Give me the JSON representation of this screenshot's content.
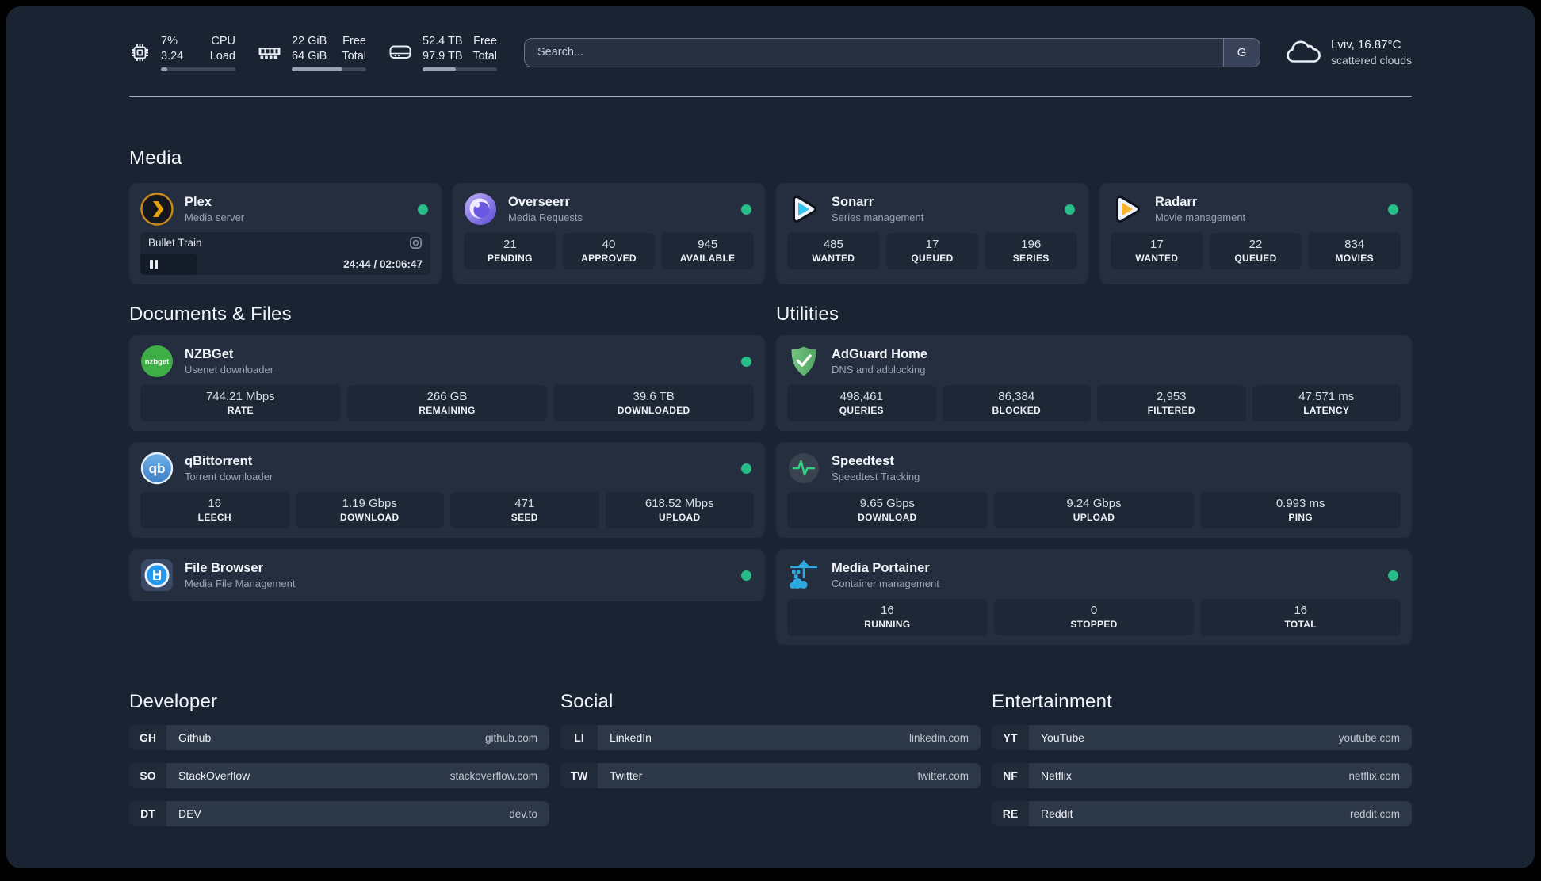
{
  "topbar": {
    "cpu": {
      "icon": "cpu-icon",
      "v1": "7%",
      "v2": "3.24",
      "l1": "CPU",
      "l2": "Load",
      "fill": "width:9%"
    },
    "memory": {
      "icon": "memory-icon",
      "v1": "22 GiB",
      "v2": "64 GiB",
      "l1": "Free",
      "l2": "Total",
      "fill": "width:68%"
    },
    "disk": {
      "icon": "disk-icon",
      "v1": "52.4 TB",
      "v2": "97.9 TB",
      "l1": "Free",
      "l2": "Total",
      "fill": "width:45%"
    },
    "search": {
      "placeholder": "Search...",
      "button_label": "G"
    },
    "weather": {
      "icon": "cloud-icon",
      "line1": "Lviv, 16.87°C",
      "line2": "scattered clouds"
    }
  },
  "media": {
    "title": "Media",
    "plex": {
      "icon": "plex-logo",
      "name": "Plex",
      "desc": "Media server",
      "status": "online",
      "player": {
        "title": "Bullet Train",
        "time": "24:44 / 02:06:47",
        "fill": "width:19.5%"
      }
    },
    "overseerr": {
      "icon": "overseerr-logo",
      "name": "Overseerr",
      "desc": "Media Requests",
      "status": "online",
      "stats": [
        {
          "value": "21",
          "label": "PENDING"
        },
        {
          "value": "40",
          "label": "APPROVED"
        },
        {
          "value": "945",
          "label": "AVAILABLE"
        }
      ]
    },
    "sonarr": {
      "icon": "sonarr-logo",
      "name": "Sonarr",
      "desc": "Series management",
      "status": "online",
      "stats": [
        {
          "value": "485",
          "label": "WANTED"
        },
        {
          "value": "17",
          "label": "QUEUED"
        },
        {
          "value": "196",
          "label": "SERIES"
        }
      ]
    },
    "radarr": {
      "icon": "radarr-logo",
      "name": "Radarr",
      "desc": "Movie management",
      "status": "online",
      "stats": [
        {
          "value": "17",
          "label": "WANTED"
        },
        {
          "value": "22",
          "label": "QUEUED"
        },
        {
          "value": "834",
          "label": "MOVIES"
        }
      ]
    }
  },
  "documents": {
    "title": "Documents & Files",
    "nzbget": {
      "icon": "nzbget-logo",
      "name": "NZBGet",
      "desc": "Usenet downloader",
      "status": "online",
      "stats": [
        {
          "value": "744.21 Mbps",
          "label": "RATE"
        },
        {
          "value": "266 GB",
          "label": "REMAINING"
        },
        {
          "value": "39.6 TB",
          "label": "DOWNLOADED"
        }
      ]
    },
    "qbittorrent": {
      "icon": "qbittorrent-logo",
      "name": "qBittorrent",
      "desc": "Torrent downloader",
      "status": "online",
      "stats": [
        {
          "value": "16",
          "label": "LEECH"
        },
        {
          "value": "1.19 Gbps",
          "label": "DOWNLOAD"
        },
        {
          "value": "471",
          "label": "SEED"
        },
        {
          "value": "618.52 Mbps",
          "label": "UPLOAD"
        }
      ]
    },
    "filebrowser": {
      "icon": "filebrowser-logo",
      "name": "File Browser",
      "desc": "Media File Management",
      "status": "online"
    }
  },
  "utilities": {
    "title": "Utilities",
    "adguard": {
      "icon": "adguard-logo",
      "name": "AdGuard Home",
      "desc": "DNS and adblocking",
      "stats": [
        {
          "value": "498,461",
          "label": "QUERIES"
        },
        {
          "value": "86,384",
          "label": "BLOCKED"
        },
        {
          "value": "2,953",
          "label": "FILTERED"
        },
        {
          "value": "47.571 ms",
          "label": "LATENCY"
        }
      ]
    },
    "speedtest": {
      "icon": "speedtest-logo",
      "name": "Speedtest",
      "desc": "Speedtest Tracking",
      "stats": [
        {
          "value": "9.65 Gbps",
          "label": "DOWNLOAD"
        },
        {
          "value": "9.24 Gbps",
          "label": "UPLOAD"
        },
        {
          "value": "0.993 ms",
          "label": "PING"
        }
      ]
    },
    "portainer": {
      "icon": "portainer-logo",
      "name": "Media Portainer",
      "desc": "Container management",
      "status": "online",
      "stats": [
        {
          "value": "16",
          "label": "RUNNING"
        },
        {
          "value": "0",
          "label": "STOPPED"
        },
        {
          "value": "16",
          "label": "TOTAL"
        }
      ]
    }
  },
  "bookmarks": {
    "developer": {
      "title": "Developer",
      "items": [
        {
          "abbr": "GH",
          "name": "Github",
          "url": "github.com"
        },
        {
          "abbr": "SO",
          "name": "StackOverflow",
          "url": "stackoverflow.com"
        },
        {
          "abbr": "DT",
          "name": "DEV",
          "url": "dev.to"
        }
      ]
    },
    "social": {
      "title": "Social",
      "items": [
        {
          "abbr": "LI",
          "name": "LinkedIn",
          "url": "linkedin.com"
        },
        {
          "abbr": "TW",
          "name": "Twitter",
          "url": "twitter.com"
        }
      ]
    },
    "entertainment": {
      "title": "Entertainment",
      "items": [
        {
          "abbr": "YT",
          "name": "YouTube",
          "url": "youtube.com"
        },
        {
          "abbr": "NF",
          "name": "Netflix",
          "url": "netflix.com"
        },
        {
          "abbr": "RE",
          "name": "Reddit",
          "url": "reddit.com"
        }
      ]
    }
  },
  "colors": {
    "status_online": "#26bd86",
    "accent_blue": "#2ea8e0",
    "page_bg": "#1a2332",
    "card_bg": "#242e3f"
  }
}
